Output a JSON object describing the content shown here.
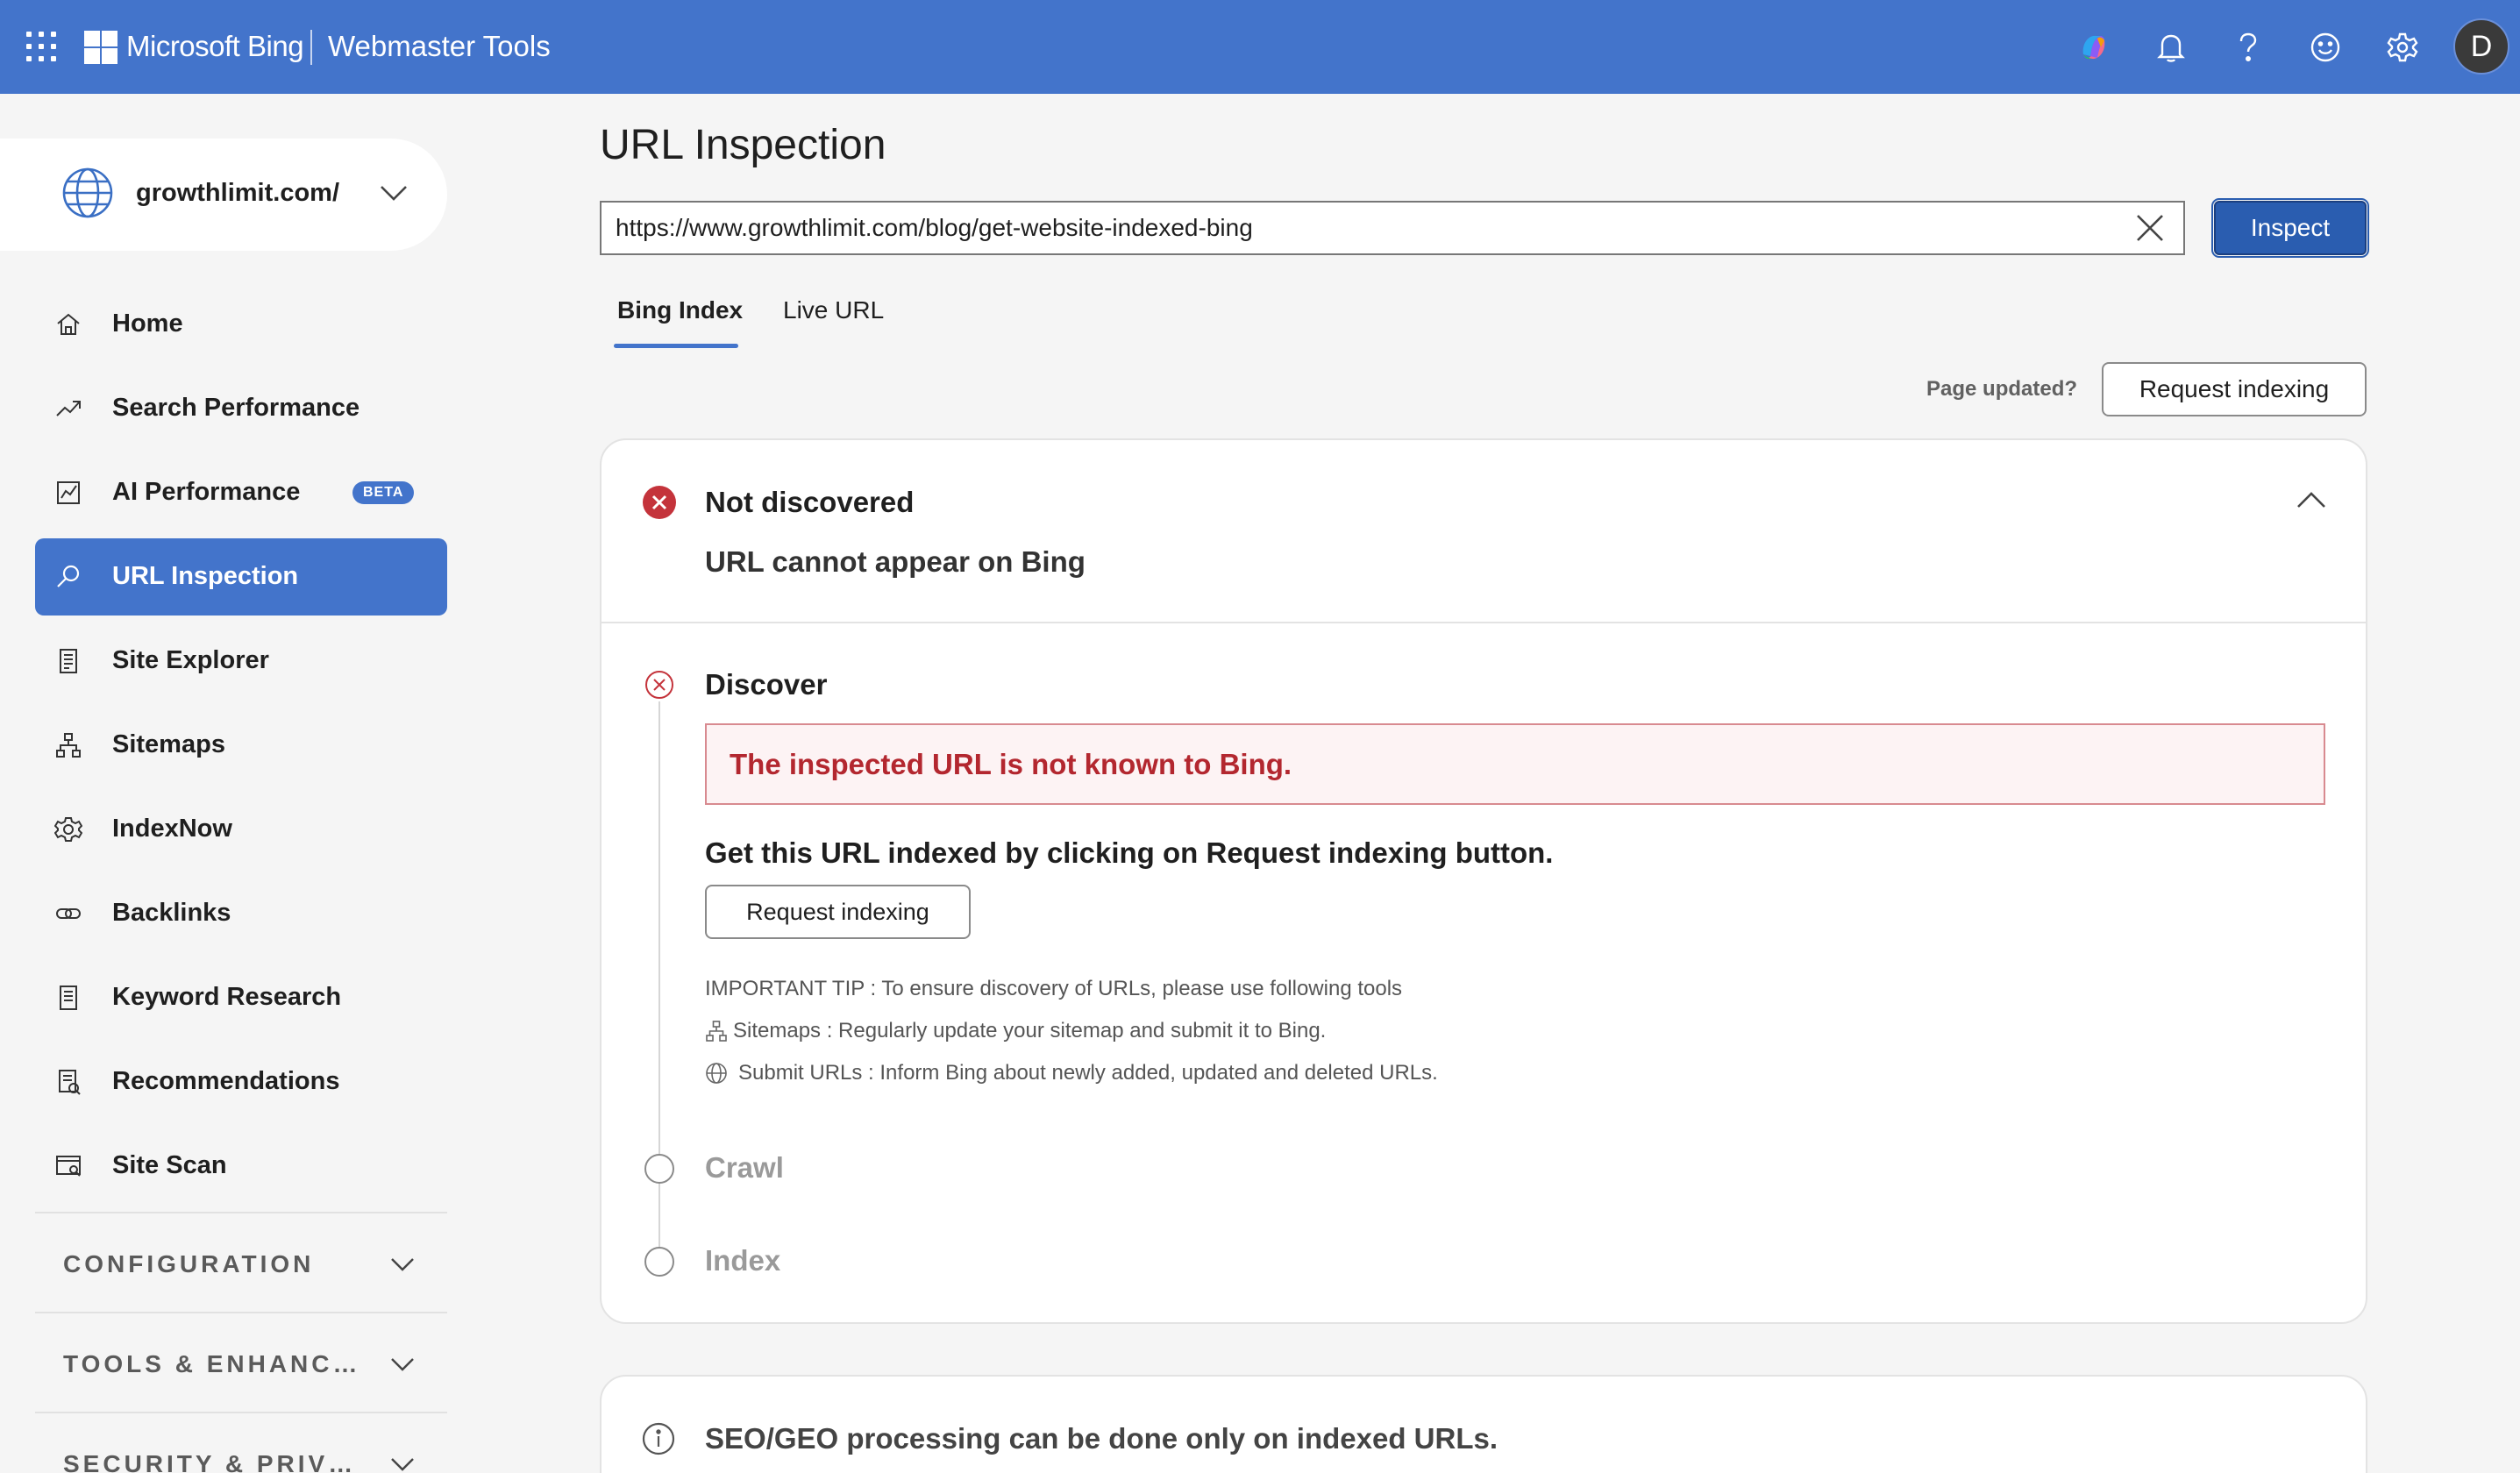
{
  "topbar": {
    "brand": "Microsoft Bing",
    "product": "Webmaster Tools",
    "icons": [
      "waffle-icon",
      "copilot-icon",
      "bell-icon",
      "help-icon",
      "smiley-icon",
      "gear-icon"
    ],
    "avatar_initial": "D"
  },
  "sidebar": {
    "site": "growthlimit.com/",
    "items": [
      {
        "label": "Home",
        "icon": "home-icon"
      },
      {
        "label": "Search Performance",
        "icon": "trend-icon"
      },
      {
        "label": "AI Performance",
        "icon": "chart-icon",
        "badge": "BETA"
      },
      {
        "label": "URL Inspection",
        "icon": "search-icon",
        "active": true
      },
      {
        "label": "Site Explorer",
        "icon": "document-icon"
      },
      {
        "label": "Sitemaps",
        "icon": "sitemap-icon"
      },
      {
        "label": "IndexNow",
        "icon": "cog-icon"
      },
      {
        "label": "Backlinks",
        "icon": "link-icon"
      },
      {
        "label": "Keyword Research",
        "icon": "list-icon"
      },
      {
        "label": "Recommendations",
        "icon": "report-icon"
      },
      {
        "label": "Site Scan",
        "icon": "scan-icon"
      }
    ],
    "sections": [
      "CONFIGURATION",
      "TOOLS & ENHANC…",
      "SECURITY & PRIV…"
    ]
  },
  "main": {
    "title": "URL Inspection",
    "url_value": "https://www.growthlimit.com/blog/get-website-indexed-bing",
    "inspect_label": "Inspect",
    "tabs": [
      {
        "label": "Bing Index",
        "active": true
      },
      {
        "label": "Live URL",
        "active": false
      }
    ],
    "page_updated": "Page updated?",
    "request_indexing": "Request indexing",
    "status": {
      "title": "Not discovered",
      "subtitle": "URL cannot appear on Bing"
    },
    "steps": {
      "discover": "Discover",
      "crawl": "Crawl",
      "index": "Index"
    },
    "error_message": "The inspected URL is not known to Bing.",
    "get_indexed": "Get this URL indexed by clicking on Request indexing button.",
    "request_indexing_inline": "Request indexing",
    "tips": {
      "heading": "IMPORTANT TIP : To ensure discovery of URLs, please use following tools",
      "sitemaps": "Sitemaps : Regularly update your sitemap and submit it to Bing.",
      "submit_urls": "Submit URLs : Inform Bing about newly added, updated and deleted URLs."
    },
    "seo_note": "SEO/GEO processing can be done only on indexed URLs."
  },
  "colors": {
    "brand_blue": "#4374cb",
    "error_red": "#c4333b",
    "error_bg": "#fdf3f4"
  }
}
